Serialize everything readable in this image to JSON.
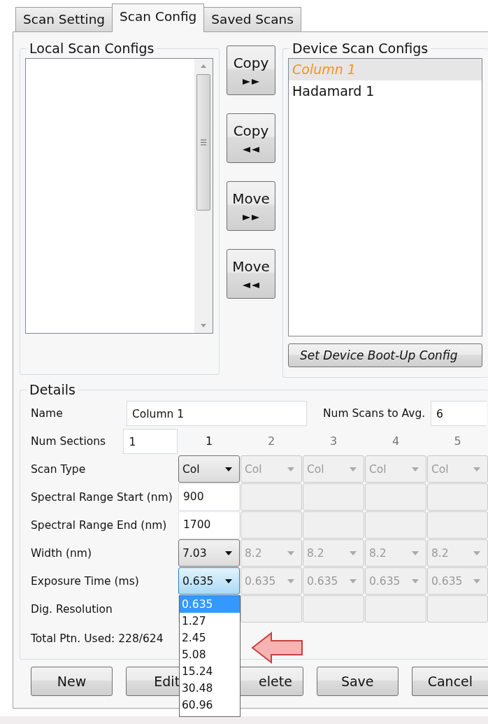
{
  "tabs": [
    {
      "label": "Scan Setting",
      "selected": false
    },
    {
      "label": "Scan Config",
      "selected": true
    },
    {
      "label": "Saved Scans",
      "selected": false
    }
  ],
  "local_configs": {
    "title": "Local Scan Configs"
  },
  "transfer_buttons": [
    {
      "label": "Copy",
      "kind": "right"
    },
    {
      "label": "Copy",
      "kind": "left"
    },
    {
      "label": "Move",
      "kind": "right"
    },
    {
      "label": "Move",
      "kind": "left"
    }
  ],
  "device_configs": {
    "title": "Device Scan Configs",
    "items": [
      {
        "label": "Column 1",
        "selected": true
      },
      {
        "label": "Hadamard 1",
        "selected": false
      }
    ],
    "boot_button": "Set Device Boot-Up Config"
  },
  "details": {
    "title": "Details",
    "name": {
      "label": "Name",
      "value": "Column 1"
    },
    "num_scans": {
      "label": "Num Scans to Avg.",
      "value": "6"
    },
    "num_sections": {
      "label": "Num Sections",
      "value": "1"
    },
    "section_headers": [
      {
        "label": "1",
        "disabled": false
      },
      {
        "label": "2",
        "disabled": true
      },
      {
        "label": "3",
        "disabled": true
      },
      {
        "label": "4",
        "disabled": true
      },
      {
        "label": "5",
        "disabled": true
      }
    ],
    "rows": [
      {
        "label": "Scan Type",
        "kind": "combo",
        "cells": [
          {
            "value": "Col",
            "disabled": false,
            "focused": false
          },
          {
            "value": "Col",
            "disabled": true,
            "focused": false
          },
          {
            "value": "Col",
            "disabled": true,
            "focused": false
          },
          {
            "value": "Col",
            "disabled": true,
            "focused": false
          },
          {
            "value": "Col",
            "disabled": true,
            "focused": false
          }
        ]
      },
      {
        "label": "Spectral Range Start (nm)",
        "kind": "text",
        "cells": [
          {
            "value": "900",
            "disabled": false
          },
          {
            "disabled": true
          },
          {
            "disabled": true
          },
          {
            "disabled": true
          },
          {
            "disabled": true
          }
        ]
      },
      {
        "label": "Spectral Range End (nm)",
        "kind": "text",
        "cells": [
          {
            "value": "1700",
            "disabled": false
          },
          {
            "disabled": true
          },
          {
            "disabled": true
          },
          {
            "disabled": true
          },
          {
            "disabled": true
          }
        ]
      },
      {
        "label": "Width (nm)",
        "kind": "combo",
        "cells": [
          {
            "value": "7.03",
            "disabled": false,
            "focused": false
          },
          {
            "value": "8.2",
            "disabled": true,
            "focused": false
          },
          {
            "value": "8.2",
            "disabled": true,
            "focused": false
          },
          {
            "value": "8.2",
            "disabled": true,
            "focused": false
          },
          {
            "value": "8.2",
            "disabled": true,
            "focused": false
          }
        ]
      },
      {
        "label": "Exposure Time (ms)",
        "kind": "combo",
        "cells": [
          {
            "value": "0.635",
            "disabled": false,
            "focused": true
          },
          {
            "value": "0.635",
            "disabled": true,
            "focused": false
          },
          {
            "value": "0.635",
            "disabled": true,
            "focused": false
          },
          {
            "value": "0.635",
            "disabled": true,
            "focused": false
          },
          {
            "value": "0.635",
            "disabled": true,
            "focused": false
          }
        ]
      },
      {
        "label": "Dig. Resolution",
        "kind": "text",
        "cells": [
          {
            "disabled": true
          },
          {
            "disabled": true
          },
          {
            "disabled": true
          },
          {
            "disabled": true
          }
        ]
      }
    ],
    "total": "Total Ptn. Used: 228/624",
    "open_list": [
      {
        "label": "0.635",
        "selected": true
      },
      {
        "label": "1.27",
        "selected": false
      },
      {
        "label": "2.45",
        "selected": false
      },
      {
        "label": "5.08",
        "selected": false
      },
      {
        "label": "15.24",
        "selected": false
      },
      {
        "label": "30.48",
        "selected": false
      },
      {
        "label": "60.96",
        "selected": false
      }
    ]
  },
  "buttons": [
    "New",
    "Edit",
    "elete",
    "Save",
    "Cancel"
  ]
}
